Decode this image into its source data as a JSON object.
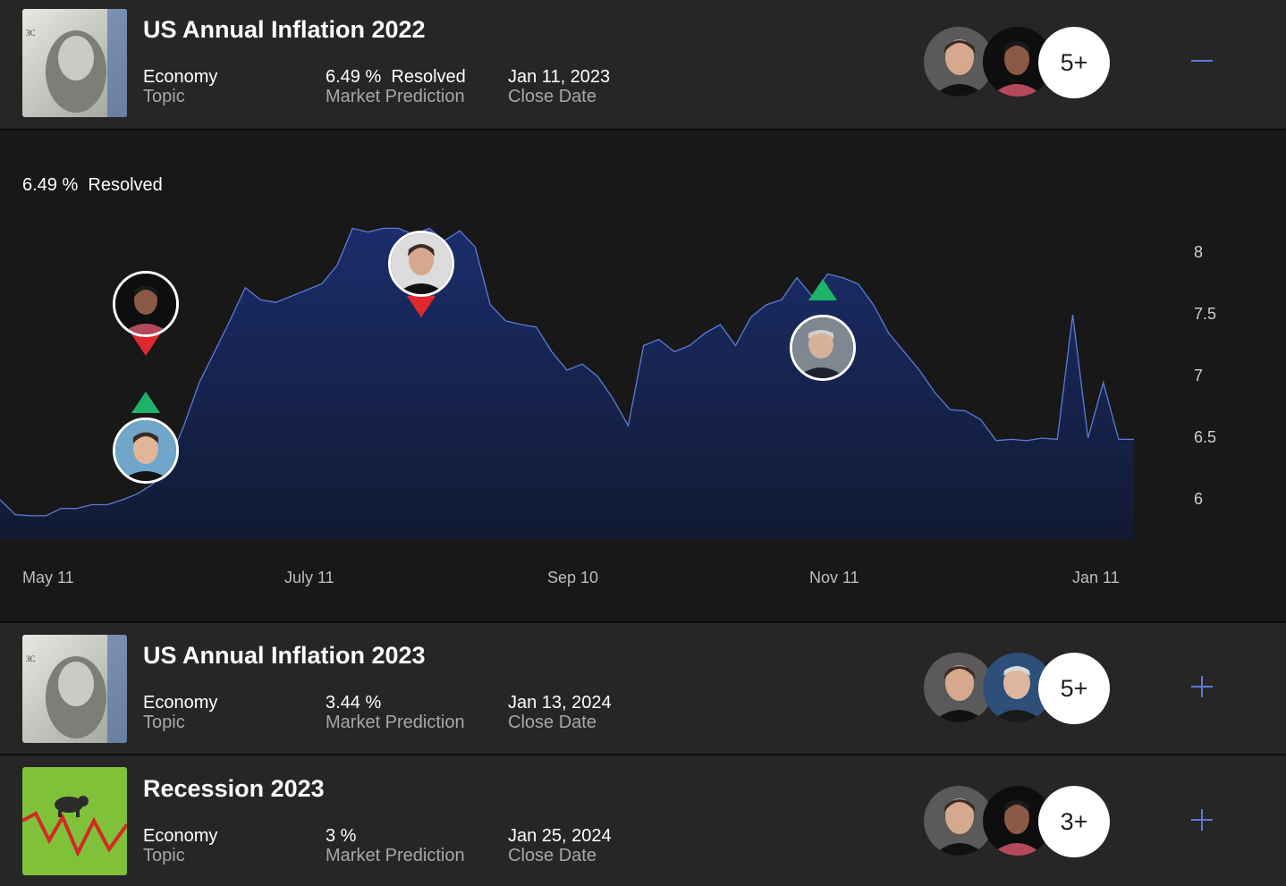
{
  "markets": [
    {
      "title": "US Annual Inflation 2022",
      "topic_value": "Economy",
      "topic_label": "Topic",
      "prediction_value": "6.49 %  Resolved",
      "prediction_label": "Market Prediction",
      "close_value": "Jan 11, 2023",
      "close_label": "Close Date",
      "participants_more": "5+",
      "toggle_icon": "minus-icon",
      "expanded": true
    },
    {
      "title": "US Annual Inflation 2023",
      "topic_value": "Economy",
      "topic_label": "Topic",
      "prediction_value": "3.44 %",
      "prediction_label": "Market Prediction",
      "close_value": "Jan 13, 2024",
      "close_label": "Close Date",
      "participants_more": "5+",
      "toggle_icon": "plus-icon",
      "expanded": false
    },
    {
      "title": "Recession 2023",
      "topic_value": "Economy",
      "topic_label": "Topic",
      "prediction_value": "3 %",
      "prediction_label": "Market Prediction",
      "close_value": "Jan 25, 2024",
      "close_label": "Close Date",
      "participants_more": "3+",
      "toggle_icon": "plus-icon",
      "expanded": false
    }
  ],
  "chart_status": "6.49 %  Resolved",
  "colors": {
    "accent": "#5b7bd6",
    "area_top": "#1b2d6b",
    "area_bottom": "#121a33",
    "up_marker": "#1db36b",
    "down_marker": "#e0282e",
    "row_bg": "#262626",
    "panel_bg": "#181818"
  },
  "chart_data": {
    "type": "area",
    "title": "",
    "xlabel": "",
    "ylabel": "",
    "x_ticks": [
      "May 11",
      "July 11",
      "Sep 10",
      "Nov 11",
      "Jan 11"
    ],
    "y_ticks": [
      "8",
      "7.5",
      "7",
      "6.5",
      "6"
    ],
    "ylim": [
      5.8,
      8.3
    ],
    "series": [
      {
        "values": [
          6.0,
          5.88,
          5.87,
          5.87,
          5.93,
          5.93,
          5.96,
          5.96,
          6.0,
          6.05,
          6.13,
          6.3,
          6.6,
          6.95,
          7.2,
          7.45,
          7.72,
          7.62,
          7.6,
          7.65,
          7.7,
          7.75,
          7.9,
          8.2,
          8.17,
          8.2,
          8.2,
          8.15,
          8.2,
          8.1,
          8.18,
          8.05,
          7.58,
          7.45,
          7.42,
          7.4,
          7.2,
          7.05,
          7.1,
          7.0,
          6.82,
          6.6,
          7.25,
          7.3,
          7.2,
          7.25,
          7.35,
          7.42,
          7.25,
          7.48,
          7.58,
          7.62,
          7.8,
          7.65,
          7.83,
          7.8,
          7.75,
          7.58,
          7.35,
          7.2,
          7.05,
          6.87,
          6.73,
          6.72,
          6.65,
          6.48,
          6.49,
          6.48,
          6.5,
          6.49,
          7.5,
          6.5,
          6.95,
          6.49,
          6.49
        ]
      }
    ],
    "grid": false,
    "legend": "none"
  },
  "prediction_markers": [
    {
      "who": "analyst-bald",
      "direction": "down",
      "date_index": 12
    },
    {
      "who": "analyst-glasses",
      "direction": "up",
      "date_index": 12
    },
    {
      "who": "elon",
      "direction": "down",
      "date_index": 31
    },
    {
      "who": "analyst-suit",
      "direction": "up",
      "date_index": 58
    }
  ]
}
